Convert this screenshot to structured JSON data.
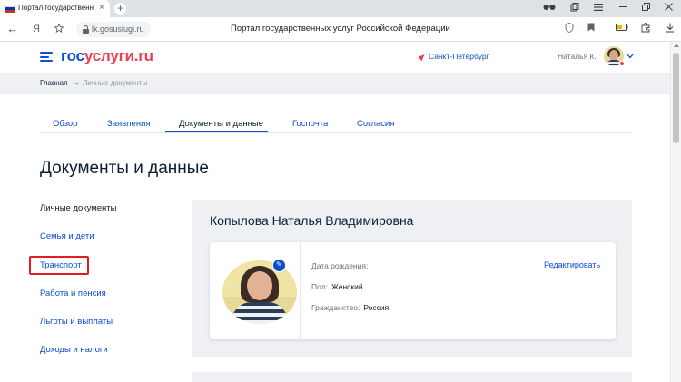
{
  "browser": {
    "tab_title": "Портал государственных",
    "tab_close": "×",
    "new_tab": "+",
    "window_controls": [
      "⌐",
      "❐",
      "–",
      "❐",
      "✕"
    ],
    "back_icon": "←",
    "yandex_icon": "Я",
    "url": "lk.gosuslugi.ru",
    "page_title": "Портал государственных услуг Российской Федерации",
    "toolbar_icons": [
      "shield-icon",
      "bookmark-icon",
      "battery-icon",
      "extension-icon",
      "download-icon"
    ]
  },
  "header": {
    "logo_part1": "гос",
    "logo_part2": "услуги",
    "logo_suffix": ".ru",
    "city": "Санкт-Петербург",
    "user_name": "Наталья К.",
    "caret": "⌄"
  },
  "breadcrumb": {
    "home": "Главная",
    "separator": "→",
    "current": "Личные документы"
  },
  "tabs": [
    {
      "label": "Обзор"
    },
    {
      "label": "Заявления"
    },
    {
      "label": "Документы и данные"
    },
    {
      "label": "Госпочта"
    },
    {
      "label": "Согласия"
    }
  ],
  "page_heading": "Документы и данные",
  "left_menu": [
    {
      "label": "Личные документы"
    },
    {
      "label": "Семья и дети"
    },
    {
      "label": "Транспорт"
    },
    {
      "label": "Работа и пенсия"
    },
    {
      "label": "Льготы и выплаты"
    },
    {
      "label": "Доходы и налоги"
    }
  ],
  "profile": {
    "full_name": "Копылова Наталья Владимировна",
    "birth_label": "Дата рождения:",
    "birth_value": "",
    "gender_label": "Пол:",
    "gender_value": "Женский",
    "citizenship_label": "Гражданство:",
    "citizenship_value": "Россия",
    "edit_label": "Редактировать",
    "edit_photo_icon": "✎"
  },
  "colors": {
    "accent": "#0d4cd3",
    "brand_red": "#ee3f58",
    "highlight": "#e31c23",
    "panel_bg": "#eef0f3"
  }
}
